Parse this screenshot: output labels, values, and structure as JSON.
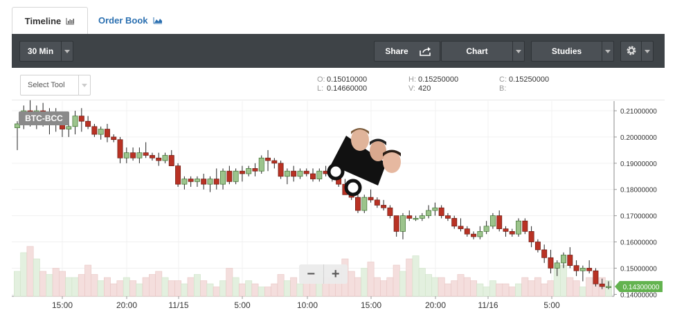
{
  "tabs": {
    "timeline": "Timeline",
    "order_book": "Order Book"
  },
  "toolbar": {
    "interval": "30 Min",
    "share": "Share",
    "chart": "Chart",
    "studies": "Studies"
  },
  "subbar": {
    "select_tool": "Select Tool"
  },
  "ohlc": {
    "o_label": "O:",
    "o_value": "0.15010000",
    "h_label": "H:",
    "h_value": "0.15250000",
    "c_label": "C:",
    "c_value": "0.15250000",
    "l_label": "L:",
    "l_value": "0.14660000",
    "v_label": "V:",
    "v_value": "420",
    "b_label": "B:",
    "b_value": ""
  },
  "zoom": {
    "minus": "−",
    "plus": "+"
  },
  "colors": {
    "up": "#6fa85a",
    "down": "#b93224",
    "up_fill": "#9cc48c",
    "price_tag": "#63b34f",
    "toolbar": "#3e4347"
  },
  "icons": {
    "timeline": "bar-chart-icon",
    "order_book": "area-chart-icon",
    "share": "share-icon",
    "settings": "gear-icon"
  },
  "chart_data": {
    "type": "candlestick",
    "symbol": "BTC-BCC",
    "interval": "30 Min",
    "x_ticks": [
      "15:00",
      "20:00",
      "11/15",
      "5:00",
      "10:00",
      "15:00",
      "20:00",
      "11/16",
      "5:00"
    ],
    "y_ticks": [
      "0.21000000",
      "0.20000000",
      "0.19000000",
      "0.18000000",
      "0.17000000",
      "0.16000000",
      "0.15000000",
      "0.14000000"
    ],
    "ylim": [
      0.1393,
      0.2137
    ],
    "last_price": "0.14300000",
    "candles": [
      {
        "o": 0.2035,
        "h": 0.206,
        "l": 0.195,
        "c": 0.205
      },
      {
        "o": 0.205,
        "h": 0.212,
        "l": 0.203,
        "c": 0.21
      },
      {
        "o": 0.21,
        "h": 0.214,
        "l": 0.204,
        "c": 0.206
      },
      {
        "o": 0.206,
        "h": 0.212,
        "l": 0.203,
        "c": 0.21
      },
      {
        "o": 0.21,
        "h": 0.213,
        "l": 0.204,
        "c": 0.205
      },
      {
        "o": 0.205,
        "h": 0.211,
        "l": 0.201,
        "c": 0.208
      },
      {
        "o": 0.208,
        "h": 0.211,
        "l": 0.202,
        "c": 0.205
      },
      {
        "o": 0.205,
        "h": 0.208,
        "l": 0.2,
        "c": 0.203
      },
      {
        "o": 0.203,
        "h": 0.206,
        "l": 0.2,
        "c": 0.204
      },
      {
        "o": 0.204,
        "h": 0.21,
        "l": 0.201,
        "c": 0.208
      },
      {
        "o": 0.208,
        "h": 0.211,
        "l": 0.202,
        "c": 0.206
      },
      {
        "o": 0.206,
        "h": 0.208,
        "l": 0.203,
        "c": 0.204
      },
      {
        "o": 0.204,
        "h": 0.205,
        "l": 0.2,
        "c": 0.201
      },
      {
        "o": 0.201,
        "h": 0.204,
        "l": 0.199,
        "c": 0.203
      },
      {
        "o": 0.203,
        "h": 0.205,
        "l": 0.198,
        "c": 0.2
      },
      {
        "o": 0.2,
        "h": 0.201,
        "l": 0.198,
        "c": 0.199
      },
      {
        "o": 0.199,
        "h": 0.2,
        "l": 0.19,
        "c": 0.192
      },
      {
        "o": 0.192,
        "h": 0.196,
        "l": 0.19,
        "c": 0.194
      },
      {
        "o": 0.194,
        "h": 0.196,
        "l": 0.191,
        "c": 0.192
      },
      {
        "o": 0.192,
        "h": 0.196,
        "l": 0.19,
        "c": 0.194
      },
      {
        "o": 0.194,
        "h": 0.198,
        "l": 0.192,
        "c": 0.193
      },
      {
        "o": 0.193,
        "h": 0.194,
        "l": 0.191,
        "c": 0.192
      },
      {
        "o": 0.192,
        "h": 0.194,
        "l": 0.189,
        "c": 0.191
      },
      {
        "o": 0.191,
        "h": 0.194,
        "l": 0.19,
        "c": 0.193
      },
      {
        "o": 0.193,
        "h": 0.195,
        "l": 0.189,
        "c": 0.189
      },
      {
        "o": 0.189,
        "h": 0.19,
        "l": 0.181,
        "c": 0.182
      },
      {
        "o": 0.182,
        "h": 0.185,
        "l": 0.18,
        "c": 0.184
      },
      {
        "o": 0.184,
        "h": 0.185,
        "l": 0.181,
        "c": 0.183
      },
      {
        "o": 0.183,
        "h": 0.185,
        "l": 0.181,
        "c": 0.184
      },
      {
        "o": 0.184,
        "h": 0.186,
        "l": 0.18,
        "c": 0.182
      },
      {
        "o": 0.182,
        "h": 0.185,
        "l": 0.179,
        "c": 0.184
      },
      {
        "o": 0.184,
        "h": 0.188,
        "l": 0.18,
        "c": 0.182
      },
      {
        "o": 0.182,
        "h": 0.188,
        "l": 0.18,
        "c": 0.187
      },
      {
        "o": 0.187,
        "h": 0.189,
        "l": 0.182,
        "c": 0.183
      },
      {
        "o": 0.183,
        "h": 0.188,
        "l": 0.182,
        "c": 0.187
      },
      {
        "o": 0.187,
        "h": 0.189,
        "l": 0.183,
        "c": 0.186
      },
      {
        "o": 0.186,
        "h": 0.189,
        "l": 0.185,
        "c": 0.188
      },
      {
        "o": 0.188,
        "h": 0.19,
        "l": 0.185,
        "c": 0.187
      },
      {
        "o": 0.187,
        "h": 0.193,
        "l": 0.186,
        "c": 0.192
      },
      {
        "o": 0.192,
        "h": 0.195,
        "l": 0.187,
        "c": 0.191
      },
      {
        "o": 0.191,
        "h": 0.192,
        "l": 0.188,
        "c": 0.19
      },
      {
        "o": 0.19,
        "h": 0.191,
        "l": 0.184,
        "c": 0.185
      },
      {
        "o": 0.185,
        "h": 0.188,
        "l": 0.182,
        "c": 0.187
      },
      {
        "o": 0.187,
        "h": 0.189,
        "l": 0.183,
        "c": 0.185
      },
      {
        "o": 0.185,
        "h": 0.188,
        "l": 0.184,
        "c": 0.187
      },
      {
        "o": 0.187,
        "h": 0.188,
        "l": 0.185,
        "c": 0.186
      },
      {
        "o": 0.186,
        "h": 0.188,
        "l": 0.183,
        "c": 0.184
      },
      {
        "o": 0.184,
        "h": 0.188,
        "l": 0.183,
        "c": 0.187
      },
      {
        "o": 0.187,
        "h": 0.189,
        "l": 0.185,
        "c": 0.186
      },
      {
        "o": 0.186,
        "h": 0.187,
        "l": 0.183,
        "c": 0.185
      },
      {
        "o": 0.185,
        "h": 0.187,
        "l": 0.181,
        "c": 0.182
      },
      {
        "o": 0.182,
        "h": 0.184,
        "l": 0.178,
        "c": 0.178
      },
      {
        "o": 0.178,
        "h": 0.18,
        "l": 0.176,
        "c": 0.177
      },
      {
        "o": 0.177,
        "h": 0.178,
        "l": 0.171,
        "c": 0.172
      },
      {
        "o": 0.172,
        "h": 0.178,
        "l": 0.171,
        "c": 0.177
      },
      {
        "o": 0.177,
        "h": 0.18,
        "l": 0.175,
        "c": 0.176
      },
      {
        "o": 0.176,
        "h": 0.177,
        "l": 0.173,
        "c": 0.174
      },
      {
        "o": 0.174,
        "h": 0.176,
        "l": 0.172,
        "c": 0.173
      },
      {
        "o": 0.173,
        "h": 0.174,
        "l": 0.169,
        "c": 0.17
      },
      {
        "o": 0.17,
        "h": 0.17,
        "l": 0.162,
        "c": 0.164
      },
      {
        "o": 0.164,
        "h": 0.171,
        "l": 0.161,
        "c": 0.17
      },
      {
        "o": 0.17,
        "h": 0.172,
        "l": 0.168,
        "c": 0.169
      },
      {
        "o": 0.169,
        "h": 0.17,
        "l": 0.168,
        "c": 0.169
      },
      {
        "o": 0.169,
        "h": 0.171,
        "l": 0.168,
        "c": 0.17
      },
      {
        "o": 0.17,
        "h": 0.174,
        "l": 0.169,
        "c": 0.172
      },
      {
        "o": 0.172,
        "h": 0.175,
        "l": 0.17,
        "c": 0.173
      },
      {
        "o": 0.173,
        "h": 0.174,
        "l": 0.169,
        "c": 0.17
      },
      {
        "o": 0.17,
        "h": 0.171,
        "l": 0.168,
        "c": 0.169
      },
      {
        "o": 0.169,
        "h": 0.17,
        "l": 0.165,
        "c": 0.166
      },
      {
        "o": 0.166,
        "h": 0.169,
        "l": 0.164,
        "c": 0.165
      },
      {
        "o": 0.165,
        "h": 0.166,
        "l": 0.162,
        "c": 0.163
      },
      {
        "o": 0.163,
        "h": 0.164,
        "l": 0.161,
        "c": 0.162
      },
      {
        "o": 0.162,
        "h": 0.166,
        "l": 0.161,
        "c": 0.164
      },
      {
        "o": 0.164,
        "h": 0.168,
        "l": 0.163,
        "c": 0.166
      },
      {
        "o": 0.166,
        "h": 0.171,
        "l": 0.165,
        "c": 0.17
      },
      {
        "o": 0.17,
        "h": 0.172,
        "l": 0.164,
        "c": 0.165
      },
      {
        "o": 0.165,
        "h": 0.166,
        "l": 0.162,
        "c": 0.164
      },
      {
        "o": 0.164,
        "h": 0.165,
        "l": 0.162,
        "c": 0.163
      },
      {
        "o": 0.163,
        "h": 0.169,
        "l": 0.162,
        "c": 0.168
      },
      {
        "o": 0.168,
        "h": 0.169,
        "l": 0.163,
        "c": 0.164
      },
      {
        "o": 0.164,
        "h": 0.166,
        "l": 0.158,
        "c": 0.16
      },
      {
        "o": 0.16,
        "h": 0.161,
        "l": 0.156,
        "c": 0.157
      },
      {
        "o": 0.157,
        "h": 0.159,
        "l": 0.152,
        "c": 0.154
      },
      {
        "o": 0.154,
        "h": 0.157,
        "l": 0.148,
        "c": 0.15
      },
      {
        "o": 0.15,
        "h": 0.153,
        "l": 0.147,
        "c": 0.152
      },
      {
        "o": 0.152,
        "h": 0.156,
        "l": 0.15,
        "c": 0.155
      },
      {
        "o": 0.155,
        "h": 0.158,
        "l": 0.15,
        "c": 0.151
      },
      {
        "o": 0.151,
        "h": 0.153,
        "l": 0.147,
        "c": 0.149
      },
      {
        "o": 0.149,
        "h": 0.151,
        "l": 0.145,
        "c": 0.15
      },
      {
        "o": 0.15,
        "h": 0.153,
        "l": 0.148,
        "c": 0.149
      },
      {
        "o": 0.149,
        "h": 0.15,
        "l": 0.143,
        "c": 0.144
      },
      {
        "o": 0.144,
        "h": 0.146,
        "l": 0.142,
        "c": 0.143
      },
      {
        "o": 0.143,
        "h": 0.145,
        "l": 0.142,
        "c": 0.143
      }
    ],
    "volume": [
      8,
      14,
      16,
      12,
      8,
      7,
      9,
      8,
      6,
      6,
      7,
      10,
      7,
      5,
      6,
      4,
      5,
      6,
      5,
      4,
      6,
      7,
      8,
      6,
      5,
      5,
      4,
      6,
      7,
      5,
      4,
      3,
      5,
      9,
      6,
      4,
      5,
      4,
      3,
      3,
      4,
      7,
      5,
      6,
      4,
      5,
      7,
      8,
      6,
      6,
      9,
      12,
      8,
      6,
      9,
      11,
      6,
      5,
      6,
      10,
      8,
      12,
      13,
      9,
      7,
      6,
      6,
      4,
      5,
      7,
      6,
      5,
      4,
      3,
      5,
      4,
      4,
      3,
      4,
      6,
      5,
      6,
      4,
      5,
      9,
      10,
      6,
      5,
      3,
      6,
      4,
      6,
      5
    ]
  }
}
